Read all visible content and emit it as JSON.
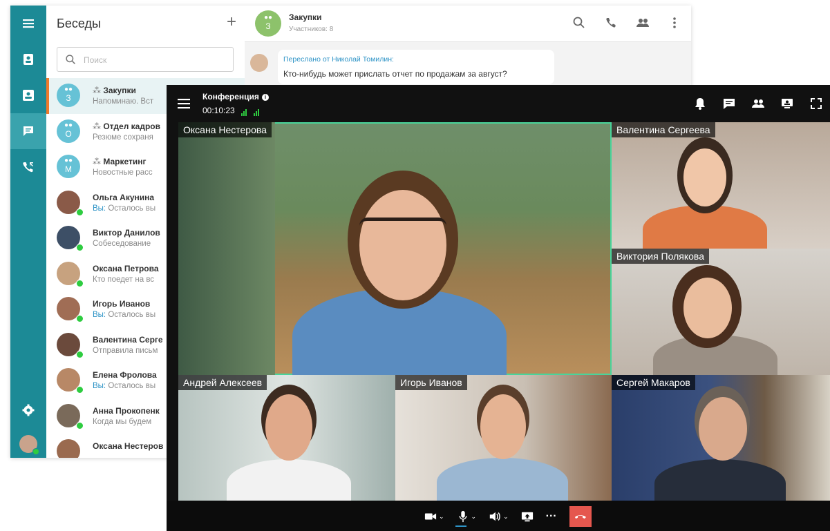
{
  "messenger": {
    "panel_title": "Беседы",
    "add_label": "+",
    "search": {
      "placeholder": "Поиск"
    },
    "conversations": [
      {
        "name": "Закупки",
        "preview": "Напоминаю. Вст",
        "group": true,
        "letter": "З",
        "active": true
      },
      {
        "name": "Отдел кадров",
        "preview": "Резюме сохраня",
        "group": true,
        "letter": "О"
      },
      {
        "name": "Маркетинг",
        "preview": "Новостные расс",
        "group": true,
        "letter": "М"
      },
      {
        "name": "Ольга Акунина",
        "you": "Вы:",
        "preview": "Осталось вы"
      },
      {
        "name": "Виктор Данилов",
        "preview": "Собеседование"
      },
      {
        "name": "Оксана Петрова",
        "preview": "Кто поедет на вс"
      },
      {
        "name": "Игорь Иванов",
        "you": "Вы:",
        "preview": "Осталось вы"
      },
      {
        "name": "Валентина Серге",
        "preview": "Отправила письм"
      },
      {
        "name": "Елена Фролова",
        "you": "Вы:",
        "preview": "Осталось вы"
      },
      {
        "name": "Анна Прокопенк",
        "preview": "Когда мы будем"
      },
      {
        "name": "Оксана Нестеров",
        "preview": ""
      }
    ],
    "chat": {
      "avatar_letter": "З",
      "title": "Закупки",
      "subtitle": "Участников: 8",
      "message": {
        "forwarded": "Переслано от Николай Томилин:",
        "text": "Кто-нибудь может прислать отчет по продажам за август?"
      }
    }
  },
  "conference": {
    "title": "Конференция",
    "info_icon": "i",
    "timer": "00:10:23",
    "participants": [
      "Оксана Нестерова",
      "Валентина Сергеева",
      "Виктория Полякова",
      "Андрей Алексеев",
      "Игорь Иванов",
      "Сергей Макаров"
    ],
    "controls": [
      "camera",
      "microphone",
      "speaker",
      "screen-share",
      "more",
      "hang-up"
    ],
    "more_label": "···"
  },
  "colors": {
    "rail": "#1c8a96",
    "active_accent": "#f0792a",
    "online": "#2ecc40",
    "hangup": "#e5574e",
    "active_speaker_border": "#49d49a"
  }
}
